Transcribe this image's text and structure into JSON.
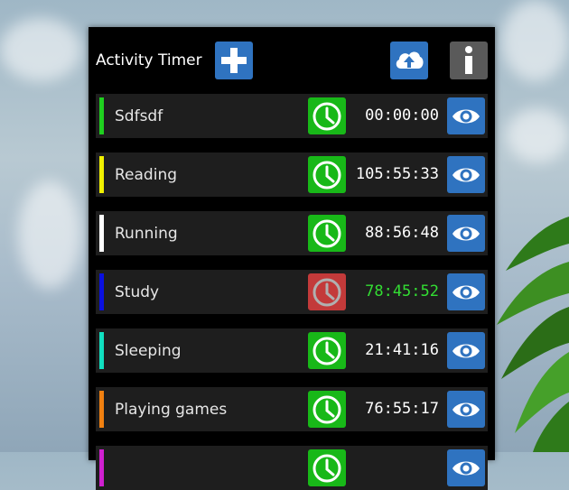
{
  "app": {
    "title": "Activity Timer"
  },
  "colors": {
    "primary": "#2f73c0",
    "info": "#5a5a5a",
    "running_clock": "#18b818",
    "stopped_clock": "#c33a3a",
    "active_time": "#33dd33",
    "idle_time": "#ffffff"
  },
  "header": {
    "add_icon": "plus-icon",
    "upload_icon": "cloud-upload-icon",
    "info_icon": "info-icon"
  },
  "activities": [
    {
      "name": "Sdfsdf",
      "time": "00:00:00",
      "color": "#1fd01f",
      "active": false
    },
    {
      "name": "Reading",
      "time": "105:55:33",
      "color": "#f0f000",
      "active": false
    },
    {
      "name": "Running",
      "time": "88:56:48",
      "color": "#ffffff",
      "active": false
    },
    {
      "name": "Study",
      "time": "78:45:52",
      "color": "#0a10e0",
      "active": true
    },
    {
      "name": "Sleeping",
      "time": "21:41:16",
      "color": "#10e0c0",
      "active": false
    },
    {
      "name": "Playing games",
      "time": "76:55:17",
      "color": "#f08010",
      "active": false
    },
    {
      "name": "",
      "time": "",
      "color": "#d020d0",
      "active": false
    }
  ]
}
